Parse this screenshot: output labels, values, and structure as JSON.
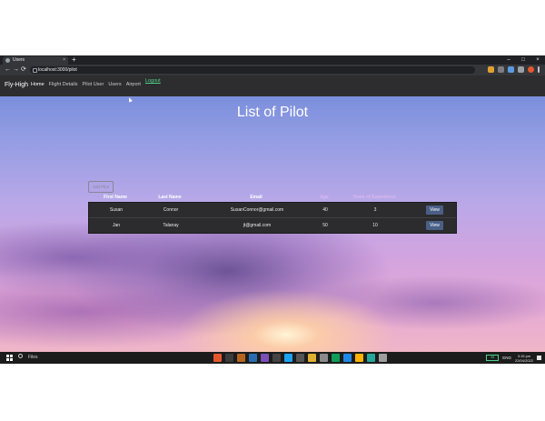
{
  "browser": {
    "tab_title": "Users",
    "tab_close": "×",
    "new_tab": "+",
    "url": "localhost:3000/pilot",
    "window_controls": [
      "–",
      "□",
      "×"
    ],
    "nav": [
      "←",
      "→",
      "⟳"
    ]
  },
  "navbar": {
    "brand": "Fly-High",
    "links": [
      "Home",
      "Flight Details",
      "Pilot User",
      "Users",
      "Airport"
    ],
    "logout": "Logout"
  },
  "page": {
    "title": "List of Pilot",
    "add_button": "Add Pilot",
    "columns": [
      "First Name",
      "Last Name",
      "Email",
      "Age",
      "Years of Experience"
    ],
    "rows": [
      {
        "first": "Susan",
        "last": "Connor",
        "email": "SusanConnor@gmail.com",
        "age": "40",
        "exp": "3",
        "action": "View"
      },
      {
        "first": "Jan",
        "last": "Talanay",
        "email": "jt@gmail.com",
        "age": "50",
        "exp": "10",
        "action": "View"
      }
    ]
  },
  "taskbar": {
    "search": "Files",
    "battery": "98",
    "lang": "ENG",
    "time": "3:15 pm",
    "date": "22/04/2022"
  },
  "colors": {
    "accent": "#4fd18b",
    "view_button": "#4a5f86",
    "navbar_bg": "#2d2d2f"
  }
}
